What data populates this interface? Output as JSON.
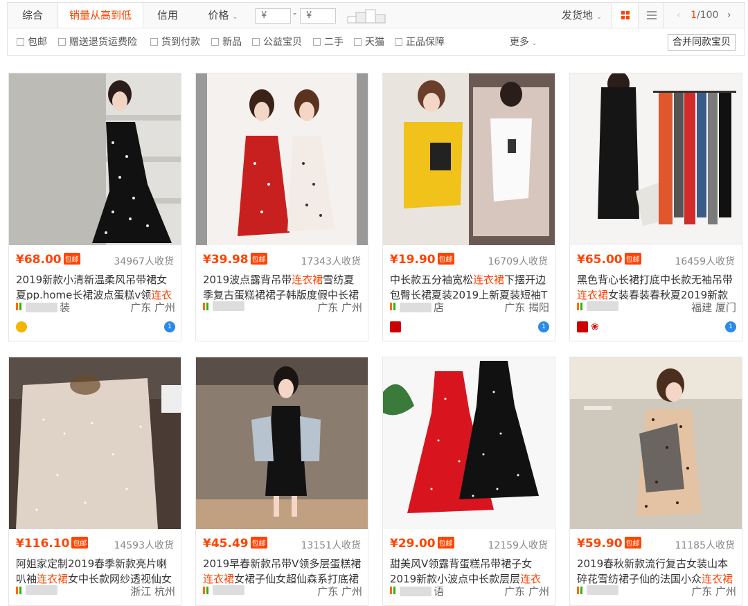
{
  "sort_bar": {
    "tabs": [
      "综合",
      "销量从高到低",
      "信用",
      "价格"
    ],
    "price_placeholder_min": "¥",
    "price_placeholder_max": "¥",
    "price_dash": "-",
    "ship_from": "发货地",
    "page_current": "1",
    "page_total": "/100",
    "colors": {
      "accent": "#ff4400",
      "active_tab_text": "#ff4400"
    }
  },
  "filter_bar": {
    "options": [
      "包邮",
      "赠送退货运费险",
      "货到付款",
      "新品",
      "公益宝贝",
      "二手",
      "天猫",
      "正品保障"
    ],
    "more": "更多",
    "merge": "合并同款宝贝"
  },
  "free_ship_tag": "包邮",
  "products": [
    {
      "price": "¥68.00",
      "sales": "34967人收货",
      "title_a": "2019新款小清新温柔风吊带裙女夏pp.home长裙波点蛋糕v领",
      "title_hl": "连衣裙",
      "title_b": "",
      "shop": "装",
      "location": "广东 广州",
      "badge_left": "gold",
      "badge_right": "1"
    },
    {
      "price": "¥39.98",
      "sales": "17343人收货",
      "title_a": "2019波点露背吊带",
      "title_hl": "连衣裙",
      "title_b": "雪纺夏季复古蛋糕裙裙子韩版度假中长裙",
      "shop": "",
      "location": "广东 广州",
      "badge_left": "",
      "badge_right": ""
    },
    {
      "price": "¥19.90",
      "sales": "16709人收货",
      "title_a": "中长款五分袖宽松",
      "title_hl": "连衣裙",
      "title_b": "下摆开边包臀长裙夏装2019上新夏装短袖T",
      "shop": "店",
      "location": "广东 揭阳",
      "badge_left": "red",
      "badge_right": "1"
    },
    {
      "price": "¥65.00",
      "sales": "16459人收货",
      "title_a": "黑色背心长裙打底中长款无袖吊带",
      "title_hl": "连衣裙",
      "title_b": "女装春装春秋夏2019新款",
      "shop": "",
      "location": "福建 厦门",
      "badge_left": "red-rose",
      "badge_right": "1"
    },
    {
      "price": "¥116.10",
      "sales": "14593人收货",
      "title_a": "阿姐家定制2019春季新款亮片喇叭袖",
      "title_hl": "连衣裙",
      "title_b": "女中长款网纱透视仙女裙",
      "shop": "",
      "location": "浙江 杭州",
      "badge_left": "",
      "badge_right": ""
    },
    {
      "price": "¥45.49",
      "sales": "13151人收货",
      "title_a": "2019早春新款吊带V领多层蛋糕裙",
      "title_hl": "连衣裙",
      "title_b": "女裙子仙女超仙森系打底裙",
      "shop": "",
      "location": "广东 广州",
      "badge_left": "",
      "badge_right": ""
    },
    {
      "price": "¥29.00",
      "sales": "12159人收货",
      "title_a": "甜美风V领露背蛋糕吊带裙子女2019新款小波点中长款层层",
      "title_hl": "连衣裙",
      "title_b": "",
      "shop": "语",
      "location": "广东 广州",
      "badge_left": "",
      "badge_right": ""
    },
    {
      "price": "¥59.90",
      "sales": "11185人收货",
      "title_a": "2019春秋新款流行复古女装山本碎花雪纺裙子仙的法国小众",
      "title_hl": "连衣裙",
      "title_b": "",
      "shop": "",
      "location": "广东 广州",
      "badge_left": "",
      "badge_right": ""
    }
  ]
}
